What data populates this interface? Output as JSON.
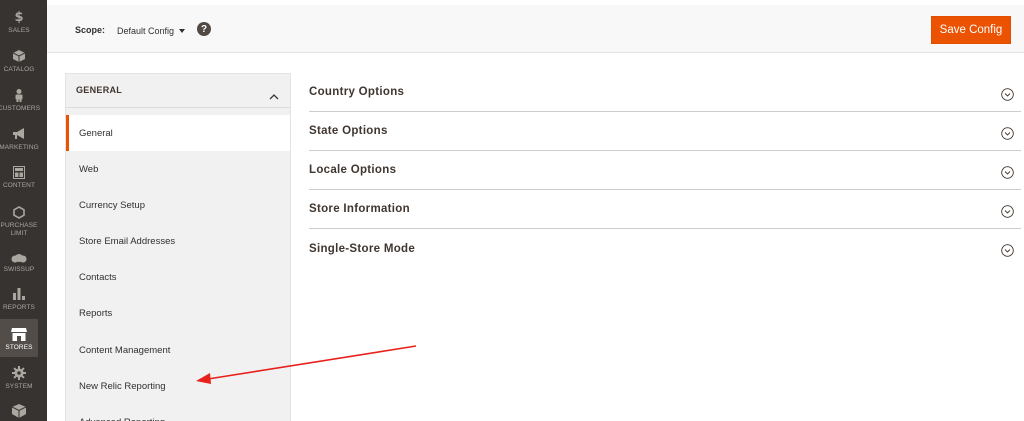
{
  "nav": {
    "items": [
      {
        "label": "SALES",
        "icon": "dollar-icon"
      },
      {
        "label": "CATALOG",
        "icon": "cube-icon"
      },
      {
        "label": "CUSTOMERS",
        "icon": "person-icon"
      },
      {
        "label": "MARKETING",
        "icon": "megaphone-icon"
      },
      {
        "label": "CONTENT",
        "icon": "layout-icon"
      },
      {
        "label": "PURCHASE",
        "label2": "LIMIT",
        "icon": "hexagon-icon"
      },
      {
        "label": "SWISSUP",
        "icon": "cloud-icon"
      },
      {
        "label": "REPORTS",
        "icon": "bar-chart-icon"
      },
      {
        "label": "STORES",
        "icon": "store-icon"
      },
      {
        "label": "SYSTEM",
        "icon": "gear-icon"
      },
      {
        "label": "",
        "icon": "box-icon"
      }
    ]
  },
  "scope": {
    "label": "Scope:",
    "value": "Default Config",
    "help": "?"
  },
  "save_button": "Save Config",
  "tabs": {
    "header": "GENERAL",
    "items": [
      {
        "label": "General"
      },
      {
        "label": "Web"
      },
      {
        "label": "Currency Setup"
      },
      {
        "label": "Store Email Addresses"
      },
      {
        "label": "Contacts"
      },
      {
        "label": "Reports"
      },
      {
        "label": "Content Management"
      },
      {
        "label": "New Relic Reporting"
      },
      {
        "label": "Advanced Reporting"
      }
    ]
  },
  "sections": [
    {
      "title": "Country Options"
    },
    {
      "title": "State Options"
    },
    {
      "title": "Locale Options"
    },
    {
      "title": "Store Information"
    },
    {
      "title": "Single-Store Mode"
    }
  ],
  "colors": {
    "accent": "#eb5202",
    "nav_bg": "#373330",
    "annotation_arrow": "#e8211b"
  }
}
